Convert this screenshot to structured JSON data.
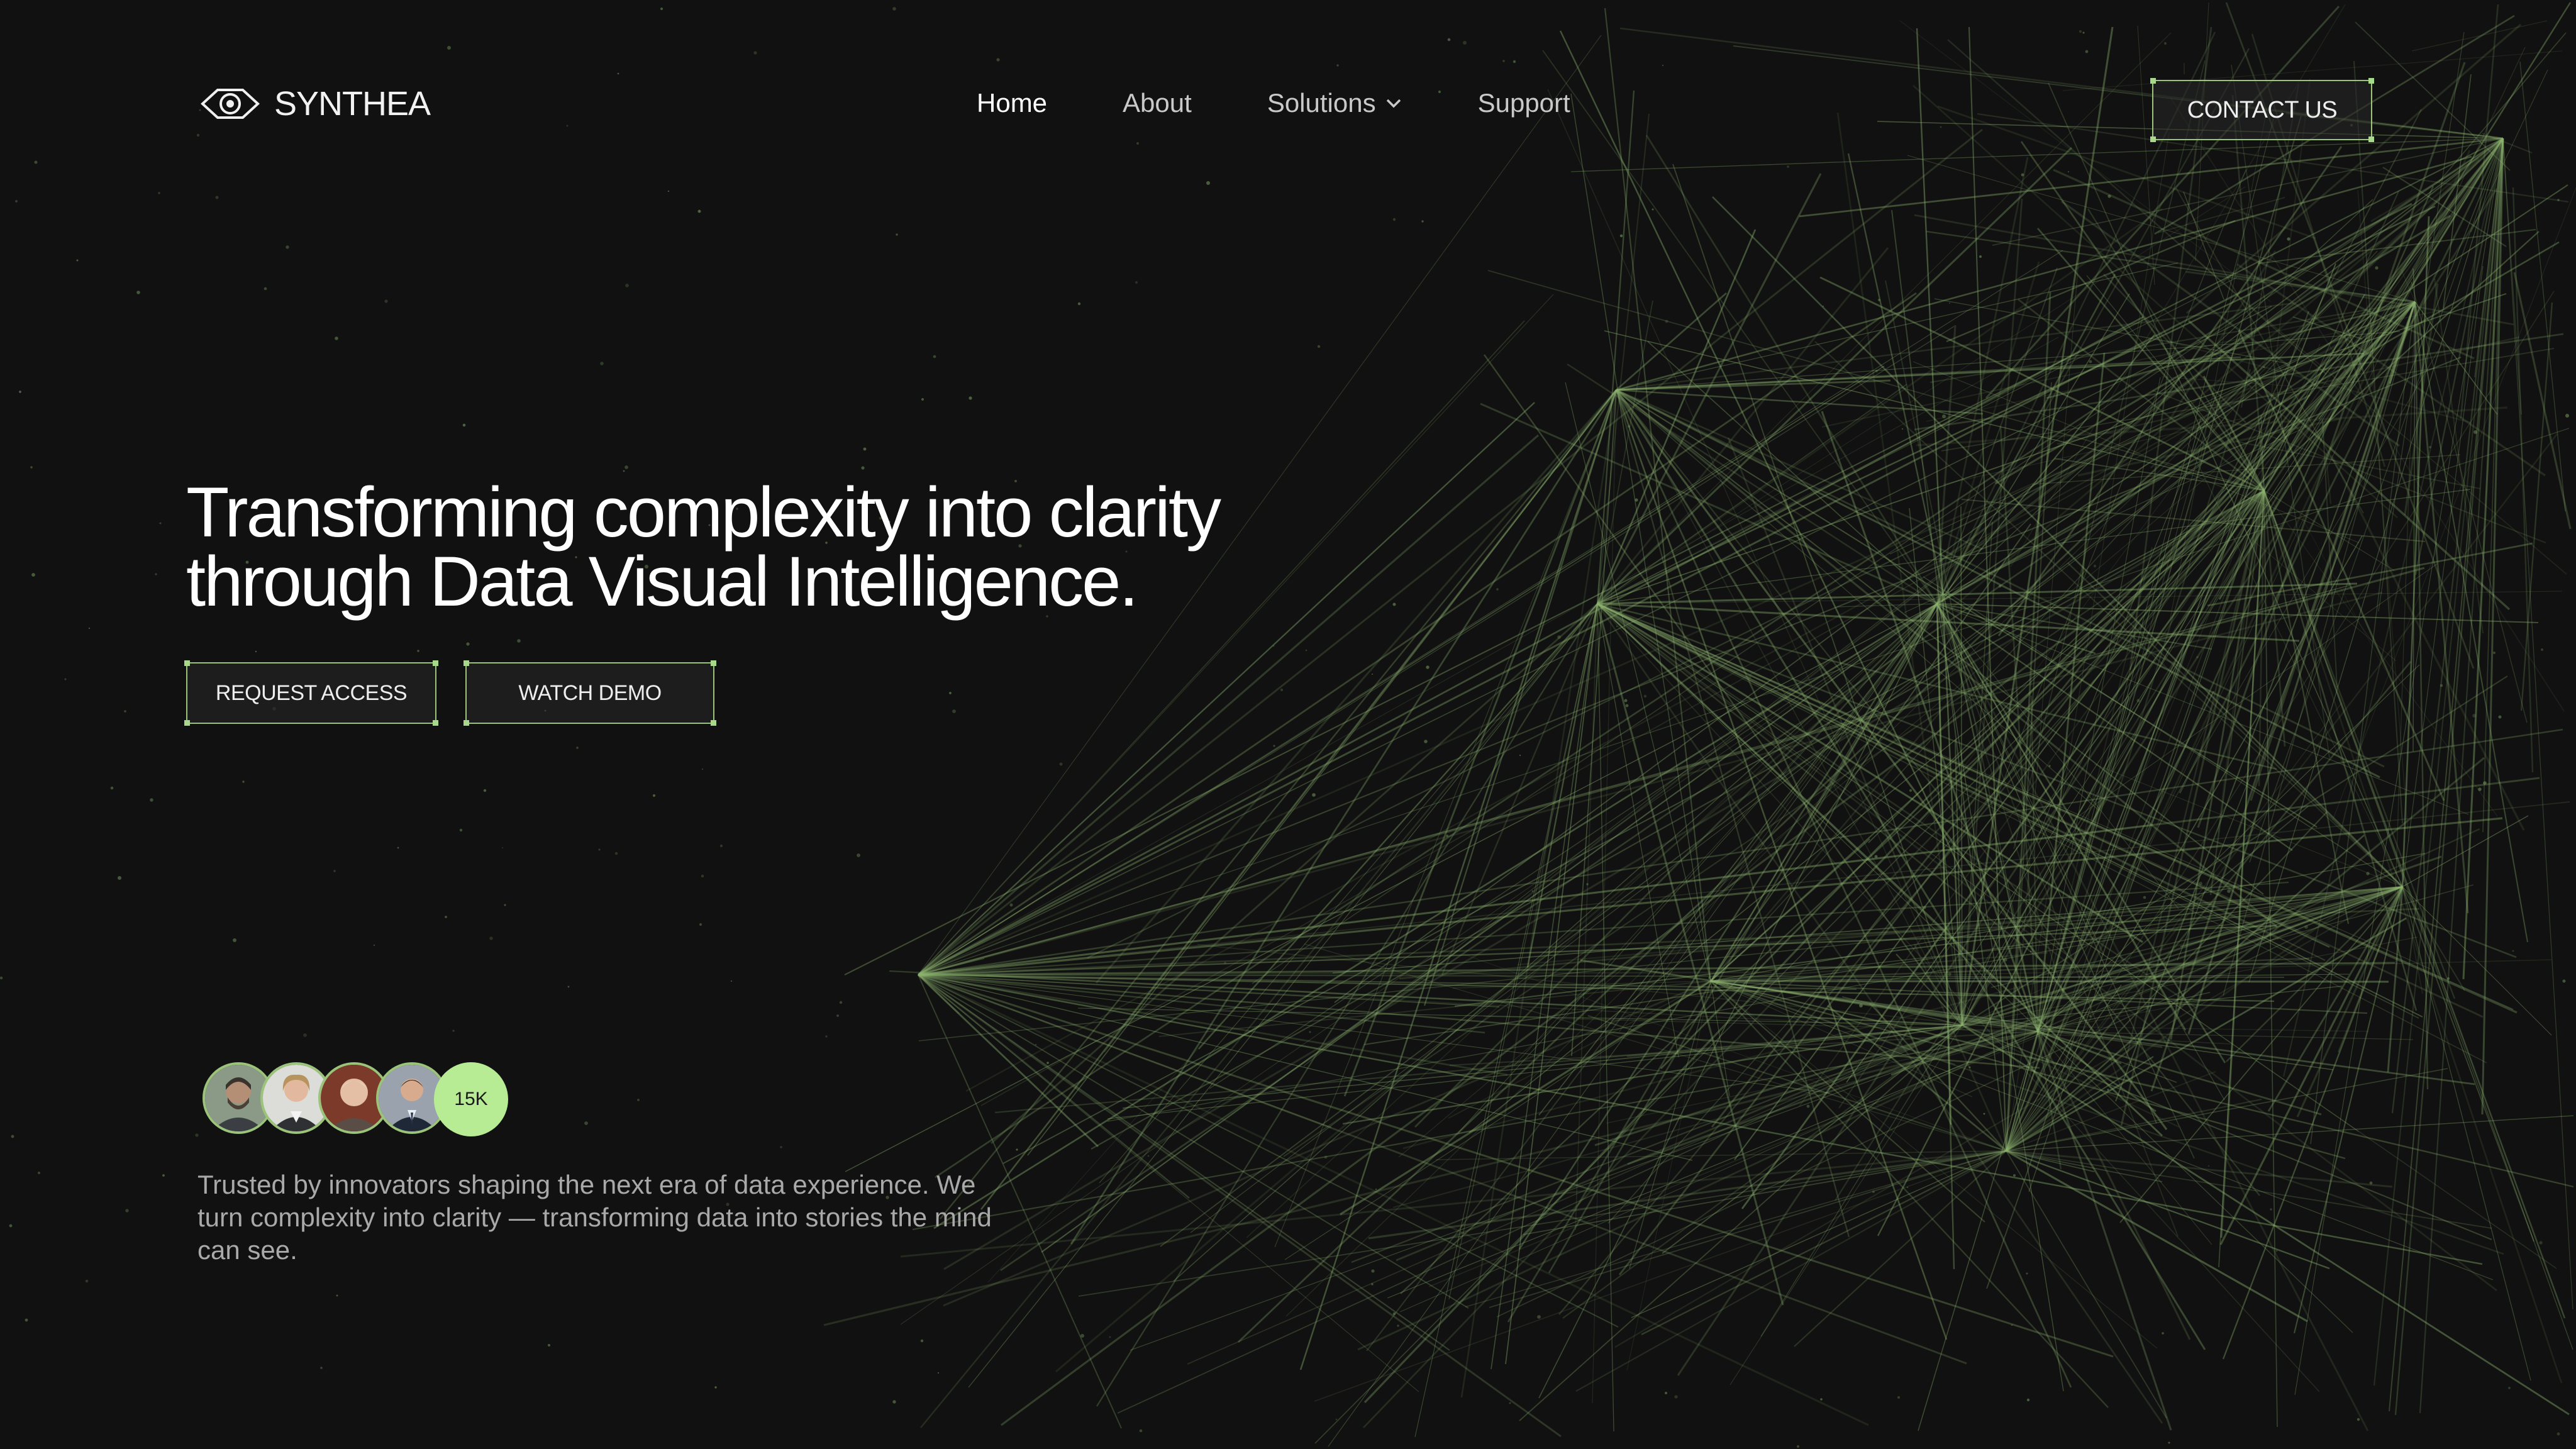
{
  "brand": {
    "name": "SYNTHEA",
    "icon": "eye-icon",
    "accent": "#9bc47a",
    "background": "#111111"
  },
  "nav": {
    "items": [
      {
        "label": "Home",
        "active": true
      },
      {
        "label": "About",
        "active": false
      },
      {
        "label": "Solutions",
        "active": false,
        "icon": "chevron-down-icon"
      },
      {
        "label": "Support",
        "active": false
      }
    ]
  },
  "header": {
    "contact_label": "CONTACT US"
  },
  "hero": {
    "headline_line1": "Transforming complexity into clarity",
    "headline_line2": "through Data Visual Intelligence.",
    "request_label": "REQUEST ACCESS",
    "demo_label": "WATCH DEMO"
  },
  "social": {
    "count": "15K",
    "tagline": "Trusted by innovators shaping the next era of data experience. We turn complexity into clarity — transforming data into stories the mind can see."
  }
}
